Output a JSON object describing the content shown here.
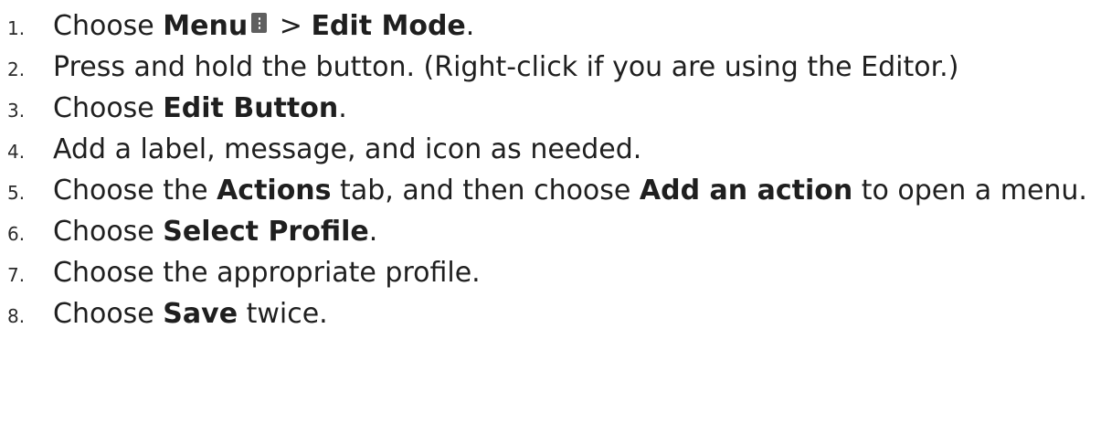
{
  "steps": [
    {
      "number": "1.",
      "segments": [
        {
          "text": "Choose ",
          "bold": false
        },
        {
          "text": "Menu",
          "bold": true
        },
        {
          "icon": "vertical-ellipsis-menu-icon"
        },
        {
          "text": " > ",
          "bold": false
        },
        {
          "text": "Edit Mode",
          "bold": true
        },
        {
          "text": ".",
          "bold": false
        }
      ]
    },
    {
      "number": "2.",
      "segments": [
        {
          "text": "Press and hold the button. (Right-click if you are using the Editor.)",
          "bold": false
        }
      ]
    },
    {
      "number": "3.",
      "segments": [
        {
          "text": "Choose ",
          "bold": false
        },
        {
          "text": "Edit Button",
          "bold": true
        },
        {
          "text": ".",
          "bold": false
        }
      ]
    },
    {
      "number": "4.",
      "segments": [
        {
          "text": "Add a label, message, and icon as needed.",
          "bold": false
        }
      ]
    },
    {
      "number": "5.",
      "segments": [
        {
          "text": "Choose the ",
          "bold": false
        },
        {
          "text": "Actions",
          "bold": true
        },
        {
          "text": " tab, and then choose ",
          "bold": false
        },
        {
          "text": "Add an action",
          "bold": true
        },
        {
          "text": " to open a menu.",
          "bold": false
        }
      ]
    },
    {
      "number": "6.",
      "segments": [
        {
          "text": "Choose ",
          "bold": false
        },
        {
          "text": "Select Profile",
          "bold": true
        },
        {
          "text": ".",
          "bold": false
        }
      ]
    },
    {
      "number": "7.",
      "segments": [
        {
          "text": "Choose the appropriate profile.",
          "bold": false
        }
      ]
    },
    {
      "number": "8.",
      "segments": [
        {
          "text": "Choose ",
          "bold": false
        },
        {
          "text": "Save",
          "bold": true
        },
        {
          "text": " twice.",
          "bold": false
        }
      ]
    }
  ]
}
